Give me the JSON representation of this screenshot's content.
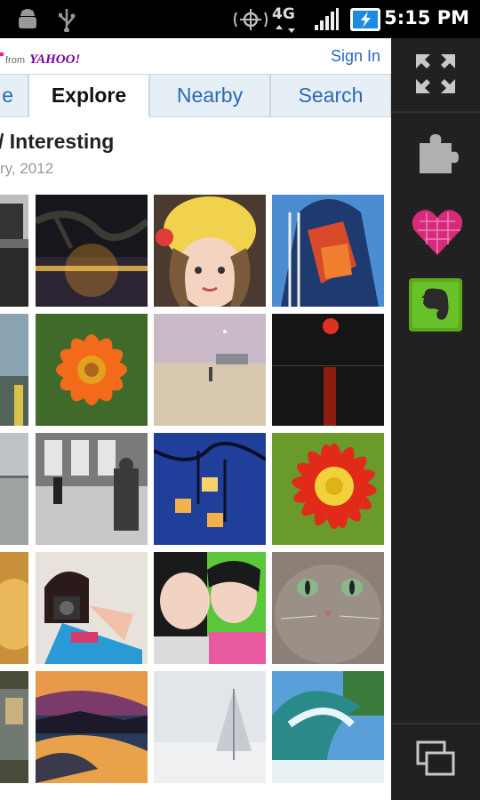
{
  "status_bar": {
    "network": "4G",
    "time": "5:15 PM"
  },
  "header": {
    "brand_from": "from",
    "brand_name": "YAHOO!",
    "sign_in": "Sign In"
  },
  "tabs": [
    {
      "label": "e"
    },
    {
      "label": "Explore"
    },
    {
      "label": "Nearby"
    },
    {
      "label": "Search"
    }
  ],
  "main": {
    "title": "/ Interesting",
    "date": "ry, 2012"
  },
  "photos": [
    "bw-street",
    "tree-night-city",
    "girl-yellow-hat",
    "graffiti-tower",
    "blue-sky-road",
    "orange-flower",
    "beach-moon",
    "red-balloon-reflection",
    "misty-water",
    "bw-man-walking",
    "blue-lanterns",
    "red-yellow-flower",
    "golden-texture",
    "girl-camera",
    "couple-portrait",
    "gray-cat",
    "building-glass",
    "sunset-river",
    "winter-tree",
    "ocean-wave"
  ],
  "sidebar": {
    "icons": [
      "fullscreen-icon",
      "puzzle-icon",
      "heart-icon",
      "evernote-icon",
      "windows-icon"
    ]
  },
  "colors": {
    "link": "#2b69b7",
    "yahoo_purple": "#7b0099",
    "sidebar_bg": "#1f1f1f"
  }
}
